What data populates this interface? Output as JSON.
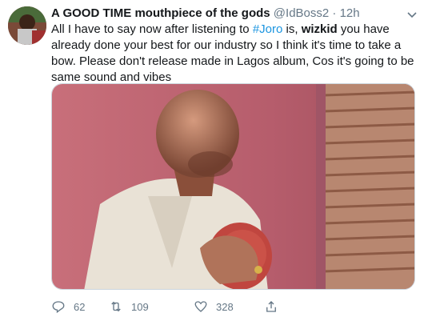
{
  "tweet": {
    "display_name": "A GOOD TIME mouthpiece of the gods",
    "handle": "@IdBoss2",
    "separator": " · ",
    "time": "12h",
    "text_parts": {
      "p1": "All I have to say now after listening to ",
      "hashtag": "#Joro",
      "p2": " is, ",
      "bold": "wizkid",
      "p3": " you have already done your best for our industry so I think it's time to take a bow. Please don't release made in Lagos album, Cos it's going to be same sound and vibes"
    }
  },
  "actions": {
    "replies": "62",
    "retweets": "109",
    "likes": "328"
  },
  "icons": [
    "chevron-down-icon",
    "reply-icon",
    "retweet-icon",
    "like-icon",
    "share-icon"
  ],
  "colors": {
    "accent": "#1b95e0",
    "muted": "#657786"
  }
}
